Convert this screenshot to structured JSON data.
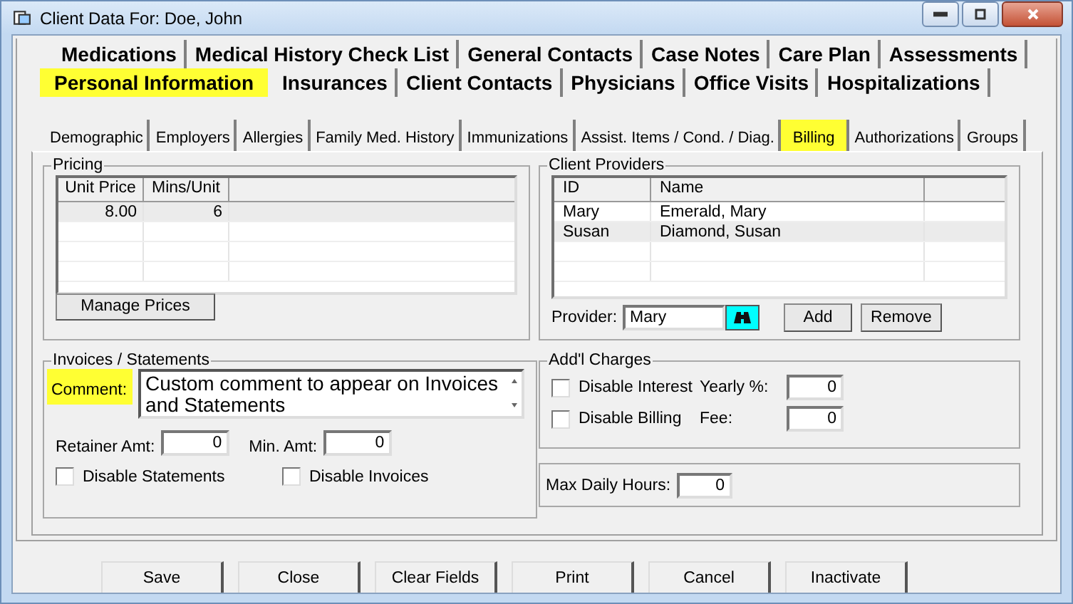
{
  "window": {
    "title": "Client Data For: Doe, John"
  },
  "main_tab_rows": [
    [
      {
        "label": "Medications",
        "selected": false,
        "highlighted": false
      },
      {
        "label": "Medical History Check List",
        "selected": false,
        "highlighted": false
      },
      {
        "label": "General Contacts",
        "selected": false,
        "highlighted": false
      },
      {
        "label": "Case Notes",
        "selected": false,
        "highlighted": false
      },
      {
        "label": "Care Plan",
        "selected": false,
        "highlighted": false
      },
      {
        "label": "Assessments",
        "selected": false,
        "highlighted": false
      }
    ],
    [
      {
        "label": "Personal Information",
        "selected": true,
        "highlighted": true
      },
      {
        "label": "Insurances",
        "selected": false,
        "highlighted": false
      },
      {
        "label": "Client Contacts",
        "selected": false,
        "highlighted": false
      },
      {
        "label": "Physicians",
        "selected": false,
        "highlighted": false
      },
      {
        "label": "Office Visits",
        "selected": false,
        "highlighted": false
      },
      {
        "label": "Hospitalizations",
        "selected": false,
        "highlighted": false
      }
    ]
  ],
  "sub_tabs": [
    {
      "label": "Demographic",
      "selected": false,
      "highlighted": false
    },
    {
      "label": "Employers",
      "selected": false,
      "highlighted": false
    },
    {
      "label": "Allergies",
      "selected": false,
      "highlighted": false
    },
    {
      "label": "Family Med. History",
      "selected": false,
      "highlighted": false
    },
    {
      "label": "Immunizations",
      "selected": false,
      "highlighted": false
    },
    {
      "label": "Assist. Items / Cond. / Diag.",
      "selected": false,
      "highlighted": false
    },
    {
      "label": "Billing",
      "selected": true,
      "highlighted": true
    },
    {
      "label": "Authorizations",
      "selected": false,
      "highlighted": false
    },
    {
      "label": "Groups",
      "selected": false,
      "highlighted": false
    }
  ],
  "pricing": {
    "title": "Pricing",
    "columns": [
      "Unit Price",
      "Mins/Unit"
    ],
    "rows": [
      {
        "cells": [
          "8.00",
          "6"
        ],
        "selected": true
      }
    ],
    "button": "Manage Prices"
  },
  "client_providers": {
    "title": "Client Providers",
    "columns": [
      "ID",
      "Name"
    ],
    "rows": [
      {
        "cells": [
          "Mary",
          "Emerald, Mary"
        ],
        "selected": false
      },
      {
        "cells": [
          "Susan",
          "Diamond, Susan"
        ],
        "selected": true
      }
    ],
    "provider_label": "Provider:",
    "provider_value": "Mary",
    "buttons": [
      "Add",
      "Remove"
    ]
  },
  "invoices": {
    "title": "Invoices / Statements",
    "comment": {
      "label": "Comment:",
      "highlighted": true,
      "value": "Custom comment to appear on Invoices and Statements"
    },
    "amounts": [
      {
        "label": "Retainer Amt:",
        "value": "0"
      },
      {
        "label": "Min. Amt:",
        "value": "0"
      }
    ],
    "checkboxes": [
      {
        "label": "Disable Statements",
        "checked": false
      },
      {
        "label": "Disable Invoices",
        "checked": false
      }
    ]
  },
  "addl_charges": {
    "title": "Add'l Charges",
    "rows": [
      {
        "checkbox": {
          "label": "Disable Interest",
          "checked": false
        },
        "field_label": "Yearly %:",
        "value": "0"
      },
      {
        "checkbox": {
          "label": "Disable Billing",
          "checked": false
        },
        "field_label": "Fee:",
        "value": "0"
      }
    ]
  },
  "max_daily_hours": {
    "label": "Max Daily Hours:",
    "value": "0"
  },
  "buttons": [
    "Save",
    "Close",
    "Clear Fields",
    "Print",
    "Cancel",
    "Inactivate"
  ]
}
